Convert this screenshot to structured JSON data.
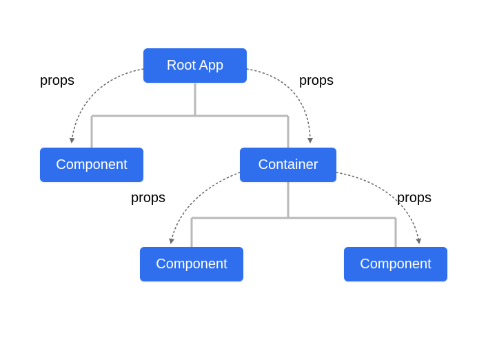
{
  "nodes": {
    "root": {
      "text": "Root App"
    },
    "comp_left": {
      "text": "Component"
    },
    "container": {
      "text": "Container"
    },
    "comp_bl": {
      "text": "Component"
    },
    "comp_br": {
      "text": "Component"
    }
  },
  "labels": {
    "props_tl": "props",
    "props_tr": "props",
    "props_bl": "props",
    "props_br": "props"
  },
  "colors": {
    "node_fill": "#2f6fed",
    "node_text": "#ffffff",
    "connector": "#b9b9b9",
    "arrow": "#6c6c6c"
  }
}
